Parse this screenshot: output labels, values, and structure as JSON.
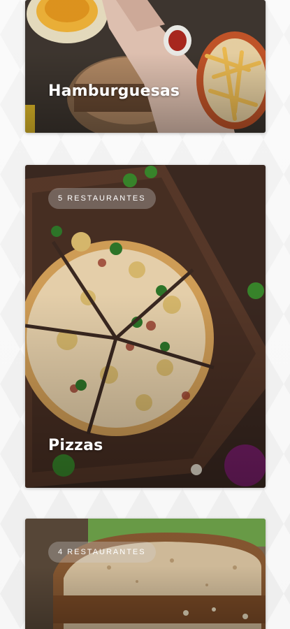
{
  "categories": [
    {
      "title": "Hamburguesas",
      "badge": "",
      "image": "burger-fries-photo"
    },
    {
      "title": "Pizzas",
      "badge": "5 RESTAURANTES",
      "image": "bbq-chicken-pizza-photo"
    },
    {
      "title": "",
      "badge": "4 RESTAURANTES",
      "image": "sandwich-photo"
    }
  ],
  "colors": {
    "background": "#f1f1f1",
    "title_text": "#ffffff",
    "badge_bg": "rgba(210,210,210,0.32)"
  }
}
